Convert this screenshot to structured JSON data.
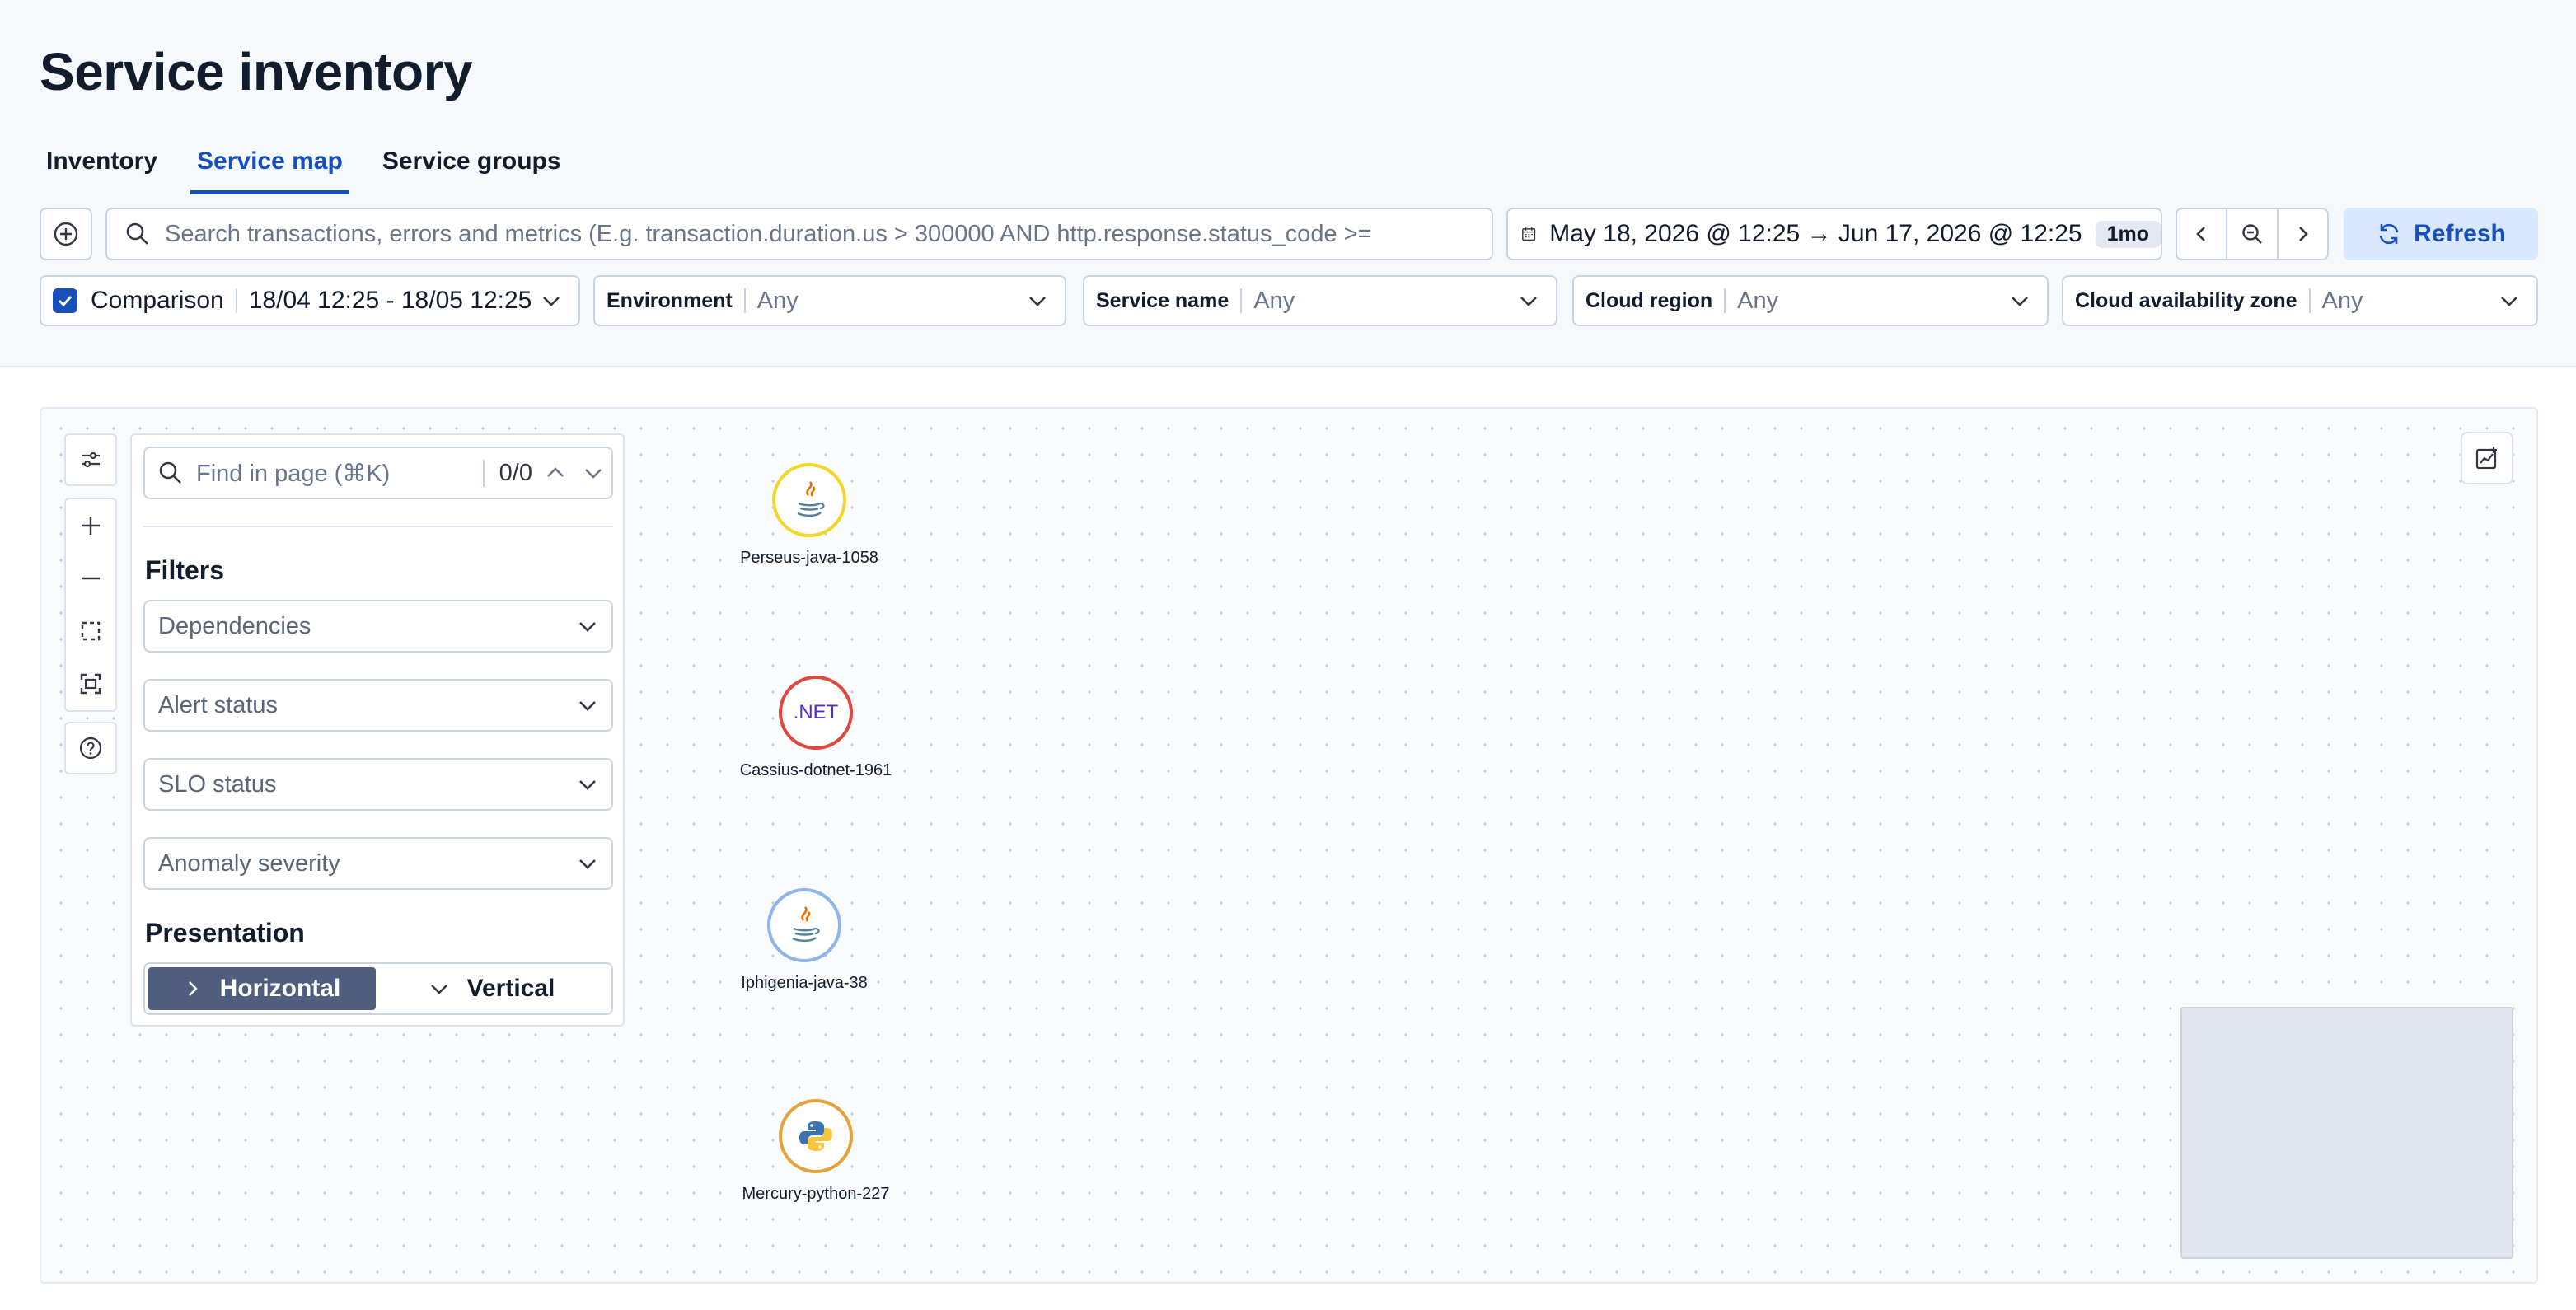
{
  "page": {
    "title": "Service inventory"
  },
  "tabs": [
    {
      "label": "Inventory",
      "active": false
    },
    {
      "label": "Service map",
      "active": true
    },
    {
      "label": "Service groups",
      "active": false
    }
  ],
  "toolbar": {
    "search_placeholder": "Search transactions, errors and metrics (E.g. transaction.duration.us > 300000 AND http.response.status_code >=",
    "date_range": "May 18, 2026 @ 12:25 → Jun 17, 2026 @ 12:25",
    "date_badge": "1mo",
    "refresh_label": "Refresh"
  },
  "filters": {
    "comparison": {
      "label": "Comparison",
      "value": "18/04 12:25 - 18/05 12:25",
      "checked": true
    },
    "environment": {
      "label": "Environment",
      "value": "Any"
    },
    "service_name": {
      "label": "Service name",
      "value": "Any"
    },
    "cloud_region": {
      "label": "Cloud region",
      "value": "Any"
    },
    "cloud_zone": {
      "label": "Cloud availability zone",
      "value": "Any"
    }
  },
  "panel": {
    "find_placeholder": "Find in page (⌘K)",
    "find_count": "0/0",
    "filters_title": "Filters",
    "dropdowns": [
      "Dependencies",
      "Alert status",
      "SLO status",
      "Anomaly severity"
    ],
    "presentation_title": "Presentation",
    "horizontal_label": "Horizontal",
    "vertical_label": "Vertical"
  },
  "nodes": [
    {
      "name": "Perseus-java-1058",
      "agent": "java-icon",
      "ring_color": "#f2d72a"
    },
    {
      "name": "Cassius-dotnet-1961",
      "agent": ".NET",
      "ring_color": "#e0473f"
    },
    {
      "name": "Iphigenia-java-38",
      "agent": "java-icon",
      "ring_color": "#8eb5ec"
    },
    {
      "name": "Mercury-python-227",
      "agent": "python-icon",
      "ring_color": "#e4a23b"
    }
  ],
  "colors": {
    "accent": "#1750ba",
    "refresh_bg": "#d9e8ff",
    "segment_on": "#4f5d7e"
  }
}
